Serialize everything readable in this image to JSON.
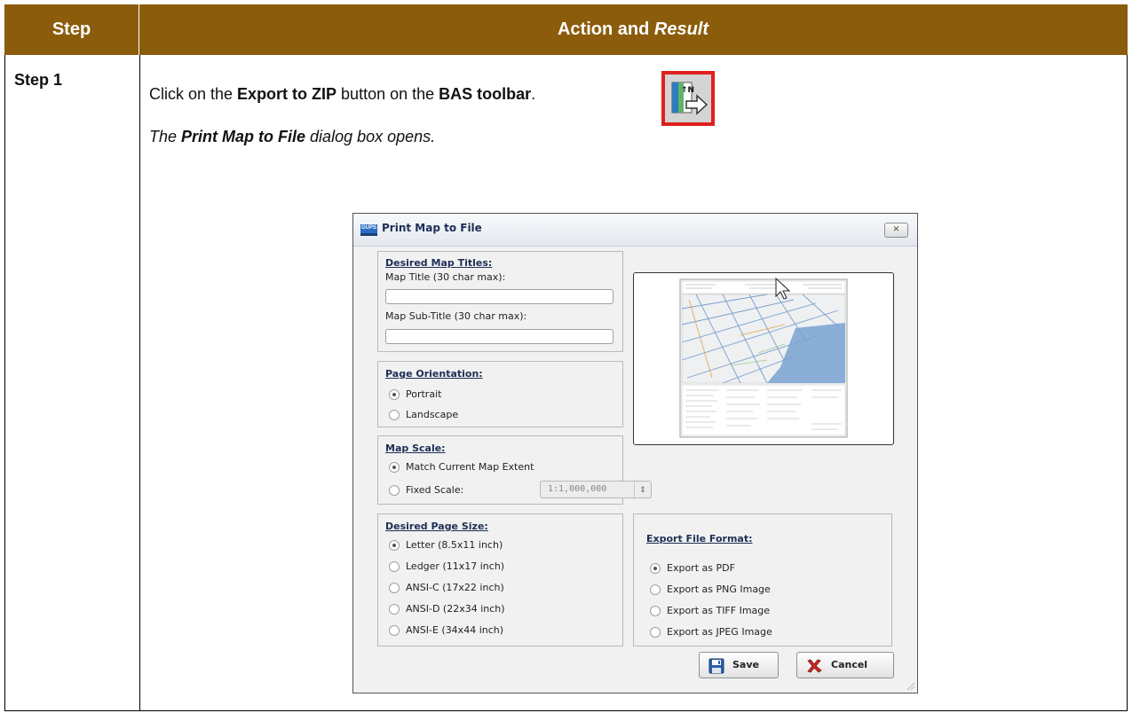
{
  "table": {
    "header_step": "Step",
    "header_action": "Action and ",
    "header_action_result": "Result"
  },
  "row": {
    "step_label": "Step 1",
    "instruction": {
      "p1": "Click on the ",
      "b1": "Export to ZIP",
      "p2": " button on the ",
      "b2": "BAS toolbar",
      "p3": "."
    },
    "result": {
      "p1": "The ",
      "b1": "Print Map to File",
      "p2": " dialog box opens."
    },
    "toolbar_icon": "export-to-zip-icon"
  },
  "dialog": {
    "title": "Print Map to File",
    "logo_text": "GUPS",
    "close_glyph": "⨯",
    "titles_group": {
      "heading": "Desired Map Titles:",
      "map_title_label": "Map Title (30 char max):",
      "map_title_value": "",
      "subtitle_label": "Map Sub-Title (30 char max):",
      "subtitle_value": ""
    },
    "orientation_group": {
      "heading": "Page Orientation:",
      "options": [
        "Portrait",
        "Landscape"
      ],
      "selected": "Portrait"
    },
    "scale_group": {
      "heading": "Map Scale:",
      "options": [
        "Match Current Map Extent",
        "Fixed Scale:"
      ],
      "selected": "Match Current Map Extent",
      "fixed_scale_value": "1:1,000,000",
      "spinner_glyph": "⇕"
    },
    "page_size_group": {
      "heading": "Desired Page Size:",
      "options": [
        "Letter (8.5x11 inch)",
        "Ledger (11x17 inch)",
        "ANSI-C (17x22 inch)",
        "ANSI-D (22x34 inch)",
        "ANSI-E (34x44 inch)"
      ],
      "selected": "Letter (8.5x11 inch)"
    },
    "format_group": {
      "heading": "Export File Format:",
      "options": [
        "Export as PDF",
        "Export as PNG Image",
        "Export as TIFF Image",
        "Export as JPEG Image"
      ],
      "selected": "Export as PDF"
    },
    "save_label": "Save",
    "cancel_label": "Cancel",
    "colors": {
      "header_band": "#8b5c0c",
      "highlight_border": "#e0201c",
      "dialog_heading": "#1c2f55"
    }
  }
}
